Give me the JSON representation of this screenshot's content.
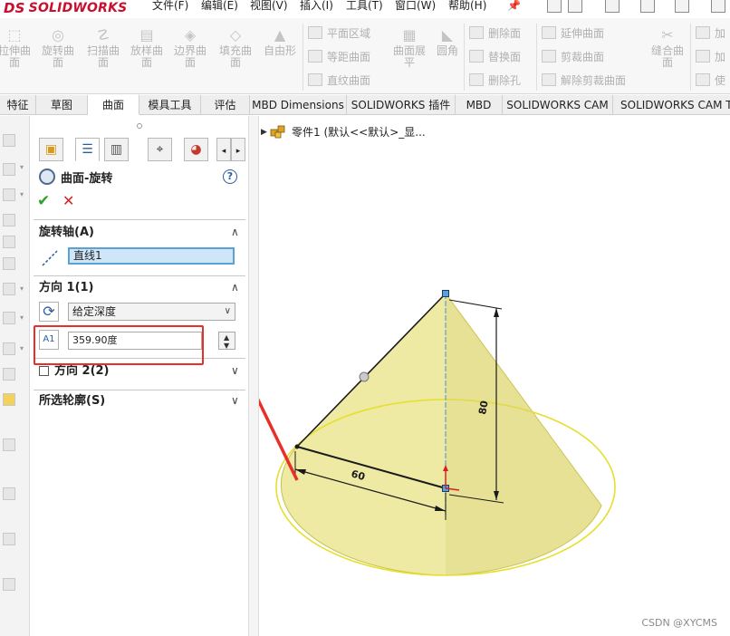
{
  "app": {
    "logo_ds": "DS",
    "logo_name": "SOLIDWORKS"
  },
  "menu": {
    "items": [
      "文件(F)",
      "编辑(E)",
      "视图(V)",
      "插入(I)",
      "工具(T)",
      "窗口(W)",
      "帮助(H)"
    ]
  },
  "toolbar": {
    "big_tools": [
      {
        "label": "拉伸曲\n面",
        "icon": "extrude-surface-icon"
      },
      {
        "label": "旋转曲\n面",
        "icon": "revolve-surface-icon"
      },
      {
        "label": "扫描曲\n面",
        "icon": "sweep-surface-icon"
      },
      {
        "label": "放样曲\n面",
        "icon": "loft-surface-icon"
      },
      {
        "label": "边界曲\n面",
        "icon": "boundary-surface-icon"
      },
      {
        "label": "填充曲\n面",
        "icon": "fill-surface-icon"
      },
      {
        "label": "自由形",
        "icon": "freeform-icon"
      }
    ],
    "group1": [
      "平面区域",
      "等距曲面",
      "直纹曲面"
    ],
    "flatten_label": "曲面展\n平",
    "fillet_label": "圆角",
    "group2": [
      "删除面",
      "替换面",
      "删除孔"
    ],
    "group3": [
      "延伸曲面",
      "剪裁曲面",
      "解除剪裁曲面"
    ],
    "knit_label": "缝合曲\n面",
    "group4": [
      "加",
      "加",
      "使"
    ]
  },
  "tabs": [
    "特征",
    "草图",
    "曲面",
    "模具工具",
    "评估",
    "MBD Dimensions",
    "SOLIDWORKS 插件",
    "MBD",
    "SOLIDWORKS CAM",
    "SOLIDWORKS CAM TBI"
  ],
  "active_tab": "曲面",
  "property_manager": {
    "title": "曲面-旋转",
    "help": "?",
    "axis_section": {
      "heading": "旋转轴(A)",
      "axis_value": "直线1"
    },
    "direction1_section": {
      "heading": "方向 1(1)",
      "end_condition": "给定深度",
      "angle_value": "359.90度",
      "angle_icon_label": "A1"
    },
    "direction2_section": {
      "heading": "方向 2(2)",
      "checked": false
    },
    "contours_section": {
      "heading": "所选轮廓(S)"
    }
  },
  "tree": {
    "part_label": "零件1 (默认<<默认>_显..."
  },
  "model": {
    "radius_dim": "60",
    "height_dim": "80",
    "fill_color": "#ece89a",
    "edge_color": "#e6df2e"
  },
  "annotation": {
    "color": "#e8302a"
  },
  "watermark": "CSDN @XYCMS"
}
